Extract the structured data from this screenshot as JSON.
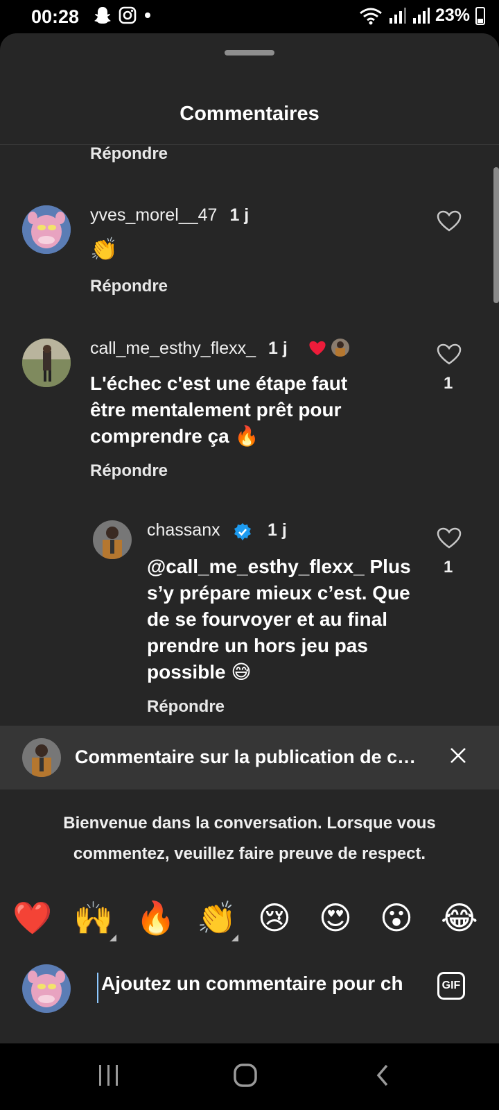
{
  "status_bar": {
    "time": "00:28",
    "battery": "23%"
  },
  "sheet": {
    "title": "Commentaires"
  },
  "reply_label": "Répondre",
  "comments": [
    {
      "username": "yves_morel__47",
      "age": "1 j",
      "text": "👏",
      "likes": ""
    },
    {
      "username": "call_me_esthy_flexx_",
      "age": "1 j",
      "text_lines": [
        "L'échec c'est une étape faut",
        "être mentalement prêt pour",
        "comprendre ça 🔥"
      ],
      "likes": "1"
    },
    {
      "username": "chassanx",
      "age": "1 j",
      "verified": true,
      "text_lines": [
        "@call_me_esthy_flexx_ Plus",
        "s’y prépare mieux c’est. Que",
        "de se fourvoyer et au final",
        "prendre un hors jeu pas",
        "possible 😅"
      ],
      "likes": "1"
    }
  ],
  "banner": {
    "text": "Commentaire sur la publication de c…"
  },
  "welcome": {
    "line1": "Bienvenue dans la conversation. Lorsque vous",
    "line2": "commentez, veuillez faire preuve de respect."
  },
  "emojis": [
    "❤️",
    "🙌",
    "🔥",
    "👏",
    "😢",
    "😍",
    "😮",
    "😂"
  ],
  "input": {
    "placeholder": "Ajoutez un commentaire pour ch",
    "gif_label": "GIF"
  },
  "colors": {
    "sheet_bg": "#262626",
    "banner_bg": "#363636",
    "heart_red": "#ed1c3a",
    "verified_blue": "#1d9bf0"
  }
}
